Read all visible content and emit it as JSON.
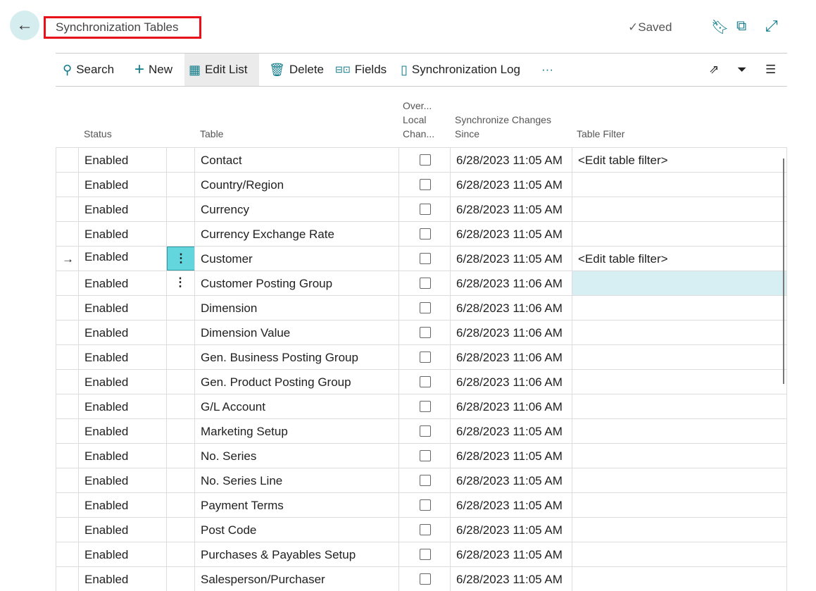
{
  "header": {
    "title": "Synchronization Tables",
    "saved": "Saved",
    "icons": [
      "back-arrow-icon",
      "bookmark-icon",
      "open-new-window-icon",
      "expand-icon"
    ]
  },
  "toolbar": {
    "items": [
      {
        "label": "Search",
        "icon": "search-icon"
      },
      {
        "label": "New",
        "icon": "plus-icon"
      },
      {
        "label": "Edit List",
        "icon": "edit-list-icon"
      },
      {
        "label": "Delete",
        "icon": "trash-icon"
      },
      {
        "label": "Fields",
        "icon": "fields-icon"
      },
      {
        "label": "Synchronization Log",
        "icon": "log-icon"
      }
    ],
    "more": "···",
    "right_icons": [
      "share-icon",
      "filter-icon",
      "list-view-icon"
    ]
  },
  "columns": {
    "status": "Status",
    "table": "Table",
    "overwrite": [
      "Over...",
      "Local",
      "Chan..."
    ],
    "since": [
      "Synchronize Changes",
      "Since"
    ],
    "filter": "Table Filter"
  },
  "rows": [
    {
      "status": "Enabled",
      "table": "Contact",
      "since": "6/28/2023 11:05 AM",
      "filter": "<Edit table filter>"
    },
    {
      "status": "Enabled",
      "table": "Country/Region",
      "since": "6/28/2023 11:05 AM",
      "filter": ""
    },
    {
      "status": "Enabled",
      "table": "Currency",
      "since": "6/28/2023 11:05 AM",
      "filter": ""
    },
    {
      "status": "Enabled",
      "table": "Currency Exchange Rate",
      "since": "6/28/2023 11:05 AM",
      "filter": ""
    },
    {
      "status": "Enabled",
      "table": "Customer",
      "since": "6/28/2023 11:05 AM",
      "filter": "<Edit table filter>",
      "current": true
    },
    {
      "status": "Enabled",
      "table": "Customer Posting Group",
      "since": "6/28/2023 11:06 AM",
      "filter": "",
      "hover": true
    },
    {
      "status": "Enabled",
      "table": "Dimension",
      "since": "6/28/2023 11:06 AM",
      "filter": ""
    },
    {
      "status": "Enabled",
      "table": "Dimension Value",
      "since": "6/28/2023 11:06 AM",
      "filter": ""
    },
    {
      "status": "Enabled",
      "table": "Gen. Business Posting Group",
      "since": "6/28/2023 11:06 AM",
      "filter": ""
    },
    {
      "status": "Enabled",
      "table": "Gen. Product Posting Group",
      "since": "6/28/2023 11:06 AM",
      "filter": ""
    },
    {
      "status": "Enabled",
      "table": "G/L Account",
      "since": "6/28/2023 11:06 AM",
      "filter": ""
    },
    {
      "status": "Enabled",
      "table": "Marketing Setup",
      "since": "6/28/2023 11:05 AM",
      "filter": ""
    },
    {
      "status": "Enabled",
      "table": "No. Series",
      "since": "6/28/2023 11:05 AM",
      "filter": ""
    },
    {
      "status": "Enabled",
      "table": "No. Series Line",
      "since": "6/28/2023 11:05 AM",
      "filter": ""
    },
    {
      "status": "Enabled",
      "table": "Payment Terms",
      "since": "6/28/2023 11:05 AM",
      "filter": ""
    },
    {
      "status": "Enabled",
      "table": "Post Code",
      "since": "6/28/2023 11:05 AM",
      "filter": ""
    },
    {
      "status": "Enabled",
      "table": "Purchases & Payables Setup",
      "since": "6/28/2023 11:05 AM",
      "filter": ""
    },
    {
      "status": "Enabled",
      "table": "Salesperson/Purchaser",
      "since": "6/28/2023 11:05 AM",
      "filter": ""
    }
  ],
  "colors": {
    "accent": "#0f7b8a",
    "current_menu": "#63d5dc",
    "hover_cell": "#d7eff2",
    "title_border": "#e8111a"
  }
}
